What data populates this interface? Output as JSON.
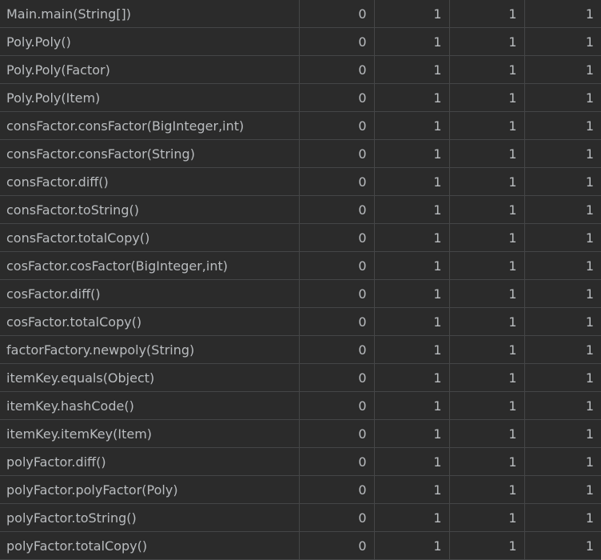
{
  "table": {
    "rows": [
      {
        "method": "Main.main(String[])",
        "c1": "0",
        "c2": "1",
        "c3": "1",
        "c4": "1"
      },
      {
        "method": "Poly.Poly()",
        "c1": "0",
        "c2": "1",
        "c3": "1",
        "c4": "1"
      },
      {
        "method": "Poly.Poly(Factor)",
        "c1": "0",
        "c2": "1",
        "c3": "1",
        "c4": "1"
      },
      {
        "method": "Poly.Poly(Item)",
        "c1": "0",
        "c2": "1",
        "c3": "1",
        "c4": "1"
      },
      {
        "method": "consFactor.consFactor(BigInteger,int)",
        "c1": "0",
        "c2": "1",
        "c3": "1",
        "c4": "1"
      },
      {
        "method": "consFactor.consFactor(String)",
        "c1": "0",
        "c2": "1",
        "c3": "1",
        "c4": "1"
      },
      {
        "method": "consFactor.diff()",
        "c1": "0",
        "c2": "1",
        "c3": "1",
        "c4": "1"
      },
      {
        "method": "consFactor.toString()",
        "c1": "0",
        "c2": "1",
        "c3": "1",
        "c4": "1"
      },
      {
        "method": "consFactor.totalCopy()",
        "c1": "0",
        "c2": "1",
        "c3": "1",
        "c4": "1"
      },
      {
        "method": "cosFactor.cosFactor(BigInteger,int)",
        "c1": "0",
        "c2": "1",
        "c3": "1",
        "c4": "1"
      },
      {
        "method": "cosFactor.diff()",
        "c1": "0",
        "c2": "1",
        "c3": "1",
        "c4": "1"
      },
      {
        "method": "cosFactor.totalCopy()",
        "c1": "0",
        "c2": "1",
        "c3": "1",
        "c4": "1"
      },
      {
        "method": "factorFactory.newpoly(String)",
        "c1": "0",
        "c2": "1",
        "c3": "1",
        "c4": "1"
      },
      {
        "method": "itemKey.equals(Object)",
        "c1": "0",
        "c2": "1",
        "c3": "1",
        "c4": "1"
      },
      {
        "method": "itemKey.hashCode()",
        "c1": "0",
        "c2": "1",
        "c3": "1",
        "c4": "1"
      },
      {
        "method": "itemKey.itemKey(Item)",
        "c1": "0",
        "c2": "1",
        "c3": "1",
        "c4": "1"
      },
      {
        "method": "polyFactor.diff()",
        "c1": "0",
        "c2": "1",
        "c3": "1",
        "c4": "1"
      },
      {
        "method": "polyFactor.polyFactor(Poly)",
        "c1": "0",
        "c2": "1",
        "c3": "1",
        "c4": "1"
      },
      {
        "method": "polyFactor.toString()",
        "c1": "0",
        "c2": "1",
        "c3": "1",
        "c4": "1"
      },
      {
        "method": "polyFactor.totalCopy()",
        "c1": "0",
        "c2": "1",
        "c3": "1",
        "c4": "1"
      }
    ]
  },
  "colors": {
    "background": "#2b2b2b",
    "text": "#b9bcbf",
    "grid": "#454647"
  }
}
